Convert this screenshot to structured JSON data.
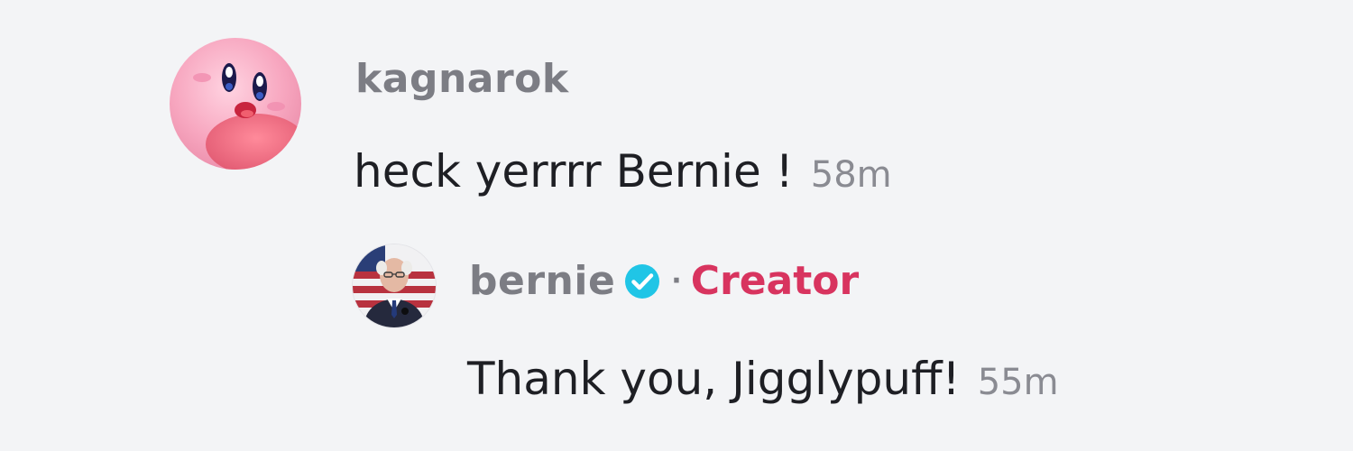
{
  "comments": [
    {
      "username": "kagnarok",
      "text": "heck yerrrr Bernie !",
      "timestamp": "58m"
    }
  ],
  "reply": {
    "username": "bernie",
    "verified": true,
    "separator": "·",
    "badge": "Creator",
    "text": "Thank you, Jigglypuff!",
    "timestamp": "55m"
  },
  "colors": {
    "background": "#f3f4f6",
    "username": "#7c7d84",
    "comment_text": "#1e1f24",
    "timestamp": "#8a8b92",
    "creator_badge": "#d8345f",
    "verified_badge": "#20c5e6"
  },
  "icons": {
    "verified": "verified-checkmark-icon"
  }
}
